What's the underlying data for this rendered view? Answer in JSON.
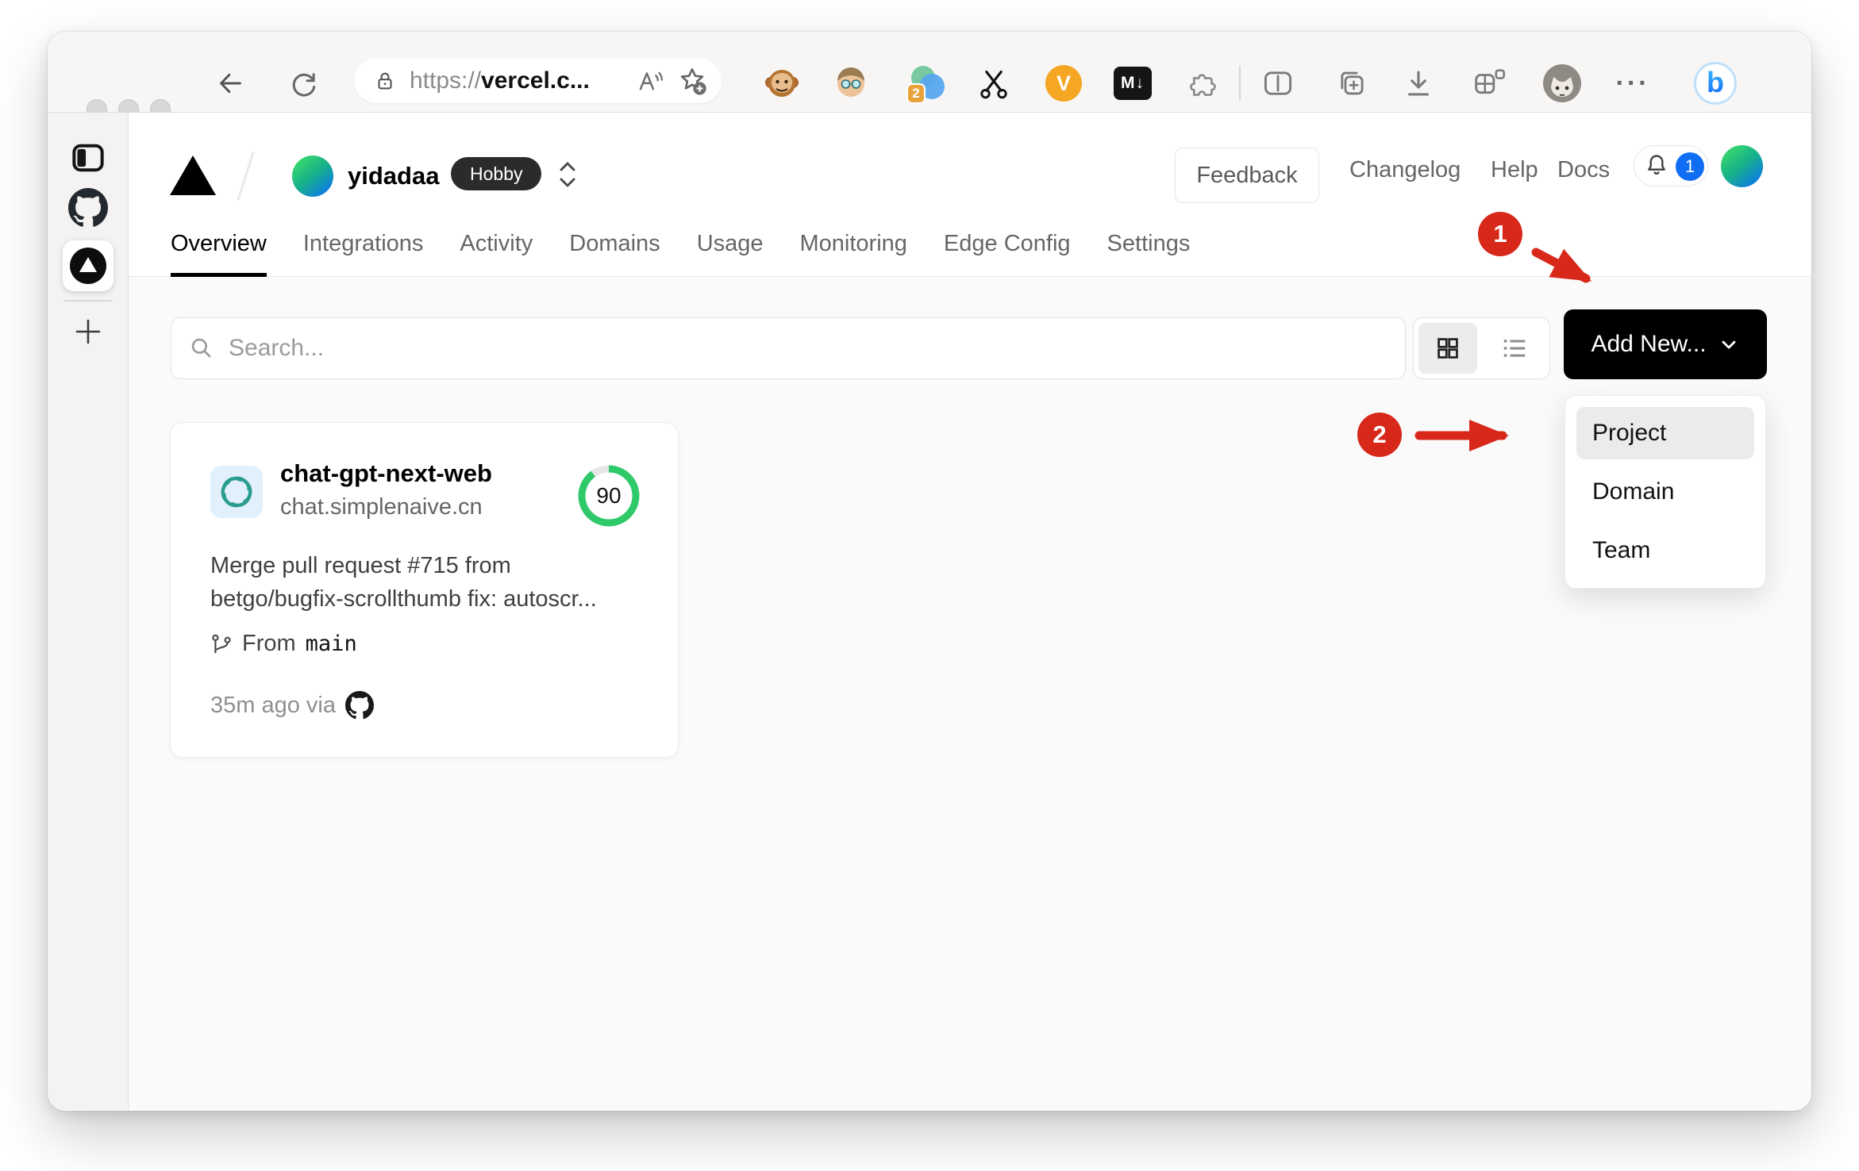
{
  "browser": {
    "url": {
      "scheme": "https://",
      "host_truncated": "vercel.c..."
    },
    "extensions": {
      "badge_count": "2",
      "v_label": "V",
      "markdown_label": "M↓"
    },
    "more_dots": "···",
    "bing_label": "b"
  },
  "vercel": {
    "header": {
      "team_name": "yidadaa",
      "plan_badge": "Hobby",
      "feedback": "Feedback",
      "changelog": "Changelog",
      "help": "Help",
      "docs": "Docs",
      "notification_count": "1"
    },
    "tabs": [
      {
        "label": "Overview",
        "active": true
      },
      {
        "label": "Integrations"
      },
      {
        "label": "Activity"
      },
      {
        "label": "Domains"
      },
      {
        "label": "Usage"
      },
      {
        "label": "Monitoring"
      },
      {
        "label": "Edge Config"
      },
      {
        "label": "Settings"
      }
    ],
    "controls": {
      "search_placeholder": "Search...",
      "add_new_label": "Add New..."
    },
    "add_new_menu": {
      "items": [
        {
          "label": "Project",
          "highlighted": true
        },
        {
          "label": "Domain"
        },
        {
          "label": "Team"
        }
      ]
    },
    "project_card": {
      "name": "chat-gpt-next-web",
      "domain": "chat.simplenaive.cn",
      "score": "90",
      "commit_line1": "Merge pull request #715 from",
      "commit_line2": "betgo/bugfix-scrollthumb fix: autoscr...",
      "branch_prefix": "From",
      "branch_name": "main",
      "deploy_meta": "35m ago via"
    }
  },
  "annotations": {
    "step1": "1",
    "step2": "2"
  },
  "colors": {
    "annotation_red": "#d7281a",
    "notification_blue": "#0f6ef3",
    "score_green": "#2fc96a",
    "plan_badge_dark": "#2b2b2b",
    "openai_teal": "#2a9d8f"
  }
}
